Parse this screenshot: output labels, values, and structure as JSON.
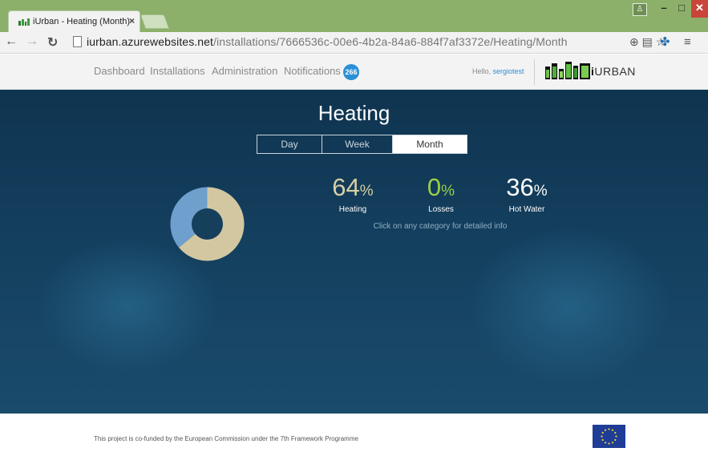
{
  "browser": {
    "tab_title": "iUrban - Heating (Month)",
    "tab_close": "×",
    "url_host": "iurban.azurewebsites.net",
    "url_path": "/installations/7666536c-00e6-4b2a-84a6-884f7af3372e/Heating/Month",
    "back_icon": "back-arrow-icon",
    "forward_icon": "forward-arrow-icon",
    "reload_icon": "reload-icon"
  },
  "header": {
    "nav": [
      "Dashboard",
      "Installations",
      "Administration",
      "Notifications"
    ],
    "notification_count": "266",
    "hello_prefix": "Hello, ",
    "username": "sergiotest",
    "logo_text_prefix": "i",
    "logo_text": "URBAN"
  },
  "main": {
    "title": "Heating",
    "period_tabs": [
      "Day",
      "Week",
      "Month"
    ],
    "active_period": "Month",
    "stats": [
      {
        "value": "64",
        "unit": "%",
        "label": "Heating",
        "color": "#d6cfa6"
      },
      {
        "value": "0",
        "unit": "%",
        "label": "Losses",
        "color": "#9ccf4a"
      },
      {
        "value": "36",
        "unit": "%",
        "label": "Hot Water",
        "color": "#ffffff"
      }
    ],
    "hint": "Click on any category for detailed info",
    "donut": {
      "heating": 64,
      "losses": 0,
      "hot_water": 36,
      "heating_color": "#d3c7a1",
      "hot_water_color": "#6f9fcd"
    }
  },
  "footer": {
    "text": "This project is co-funded by the European Commission under the 7th Framework Programme"
  }
}
